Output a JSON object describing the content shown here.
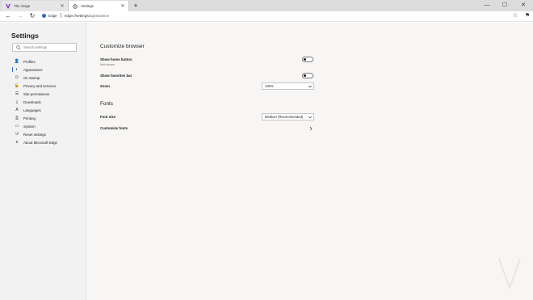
{
  "tabs": [
    {
      "title": "The Verge",
      "active": false,
      "favicon": "verge-icon",
      "close_glyph": "✕"
    },
    {
      "title": "Settings",
      "active": true,
      "favicon": "gear-icon",
      "close_glyph": "✕"
    }
  ],
  "newtab_glyph": "+",
  "window_controls": {
    "minimize": "—",
    "maximize": "☐",
    "close": "✕"
  },
  "toolbar": {
    "back_glyph": "←",
    "forward_glyph": "→",
    "refresh_glyph": "↻",
    "site_label": "Edge",
    "url_host": "edge://",
    "url_path_bold": "settings",
    "url_path_rest": "/appearance",
    "favorite_glyph": "☆",
    "extension_glyph": "⚑"
  },
  "sidebar": {
    "title": "Settings",
    "search_placeholder": "Search settings",
    "items": [
      {
        "label": "Profiles",
        "icon": "person-icon",
        "glyph": "👤",
        "selected": false
      },
      {
        "label": "Appearance",
        "icon": "appearance-icon",
        "glyph": "◐",
        "selected": true
      },
      {
        "label": "On startup",
        "icon": "power-icon",
        "glyph": "⏻",
        "selected": false
      },
      {
        "label": "Privacy and services",
        "icon": "lock-icon",
        "glyph": "🔒",
        "selected": false
      },
      {
        "label": "Site permissions",
        "icon": "permissions-icon",
        "glyph": "☰",
        "selected": false
      },
      {
        "label": "Downloads",
        "icon": "download-icon",
        "glyph": "⤓",
        "selected": false
      },
      {
        "label": "Languages",
        "icon": "languages-icon",
        "glyph": "A",
        "selected": false
      },
      {
        "label": "Printing",
        "icon": "printer-icon",
        "glyph": "⎙",
        "selected": false
      },
      {
        "label": "System",
        "icon": "system-icon",
        "glyph": "▭",
        "selected": false
      },
      {
        "label": "Reset settings",
        "icon": "reset-icon",
        "glyph": "↺",
        "selected": false
      },
      {
        "label": "About Microsoft Edge",
        "icon": "edge-logo-icon",
        "glyph": "e",
        "selected": false
      }
    ]
  },
  "main": {
    "customize_title": "Customize browser",
    "home_button_label": "Show home button",
    "home_button_sub": "Not shown",
    "favorites_bar_label": "Show favorites bar",
    "zoom_label": "Zoom",
    "zoom_value": "100%",
    "fonts_title": "Fonts",
    "font_size_label": "Font size",
    "font_size_value": "Medium (Recommended)",
    "customize_fonts_label": "Customize fonts"
  },
  "colors": {
    "accent": "#2a6bd1",
    "verge_brand": "#6c2ad8",
    "sidebar_bg": "#f2f2f2",
    "content_bg": "#f7f6f5"
  }
}
